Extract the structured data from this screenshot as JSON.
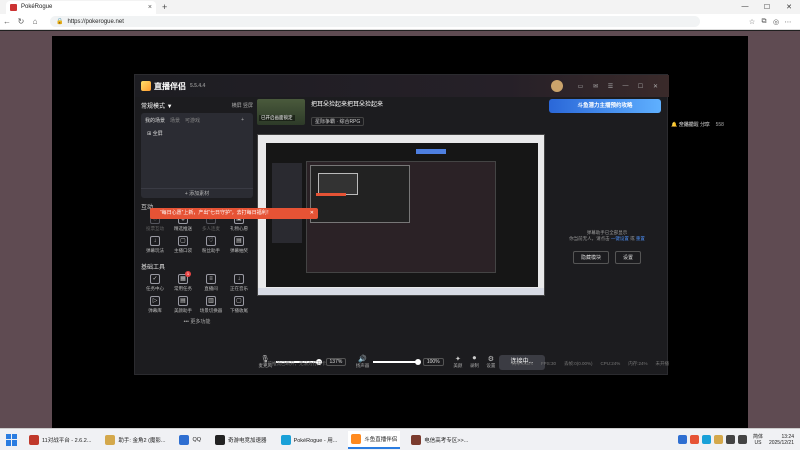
{
  "browser": {
    "tab_title": "PokéRogue",
    "url": "https://pokerogue.net"
  },
  "app": {
    "name": "直播伴侣",
    "version": "5.5.4.4",
    "left": {
      "mode_label": "常规模式 ▼",
      "mode_switch": "横屏  竖屏",
      "scene_tabs": [
        "我的场景",
        "场景",
        "可游戏"
      ],
      "scene_item": "全屏",
      "add_material": "+ 添加素材",
      "interactive_title": "互动",
      "interactive_items": [
        {
          "icon": "gift-icon",
          "label": "投票互动",
          "dim": true
        },
        {
          "icon": "shield-icon",
          "label": "精选推送",
          "dim": false
        },
        {
          "icon": "users-icon",
          "label": "多人连麦",
          "dim": true
        },
        {
          "icon": "gift-box-icon",
          "label": "礼物心愿",
          "dim": false
        },
        {
          "icon": "download-icon",
          "label": "弹幕玩法",
          "dim": false
        },
        {
          "icon": "cart-icon",
          "label": "主播口袋",
          "dim": false
        },
        {
          "icon": "star-icon",
          "label": "粉丝助手",
          "dim": false
        },
        {
          "icon": "image-icon",
          "label": "弹幕抽奖",
          "dim": false
        }
      ],
      "tools_title": "基础工具",
      "tool_items": [
        {
          "icon": "task-icon",
          "label": "任务中心",
          "badge": ""
        },
        {
          "icon": "calendar-icon",
          "label": "常用任务",
          "badge": "1"
        },
        {
          "icon": "list-icon",
          "label": "直播间",
          "badge": ""
        },
        {
          "icon": "download-icon",
          "label": "正在音乐",
          "badge": ""
        },
        {
          "icon": "play-icon",
          "label": "弹幕库",
          "badge": ""
        },
        {
          "icon": "image-icon",
          "label": "美颜助手",
          "badge": ""
        },
        {
          "icon": "grid-icon",
          "label": "场景切换器",
          "badge": ""
        },
        {
          "icon": "frame-icon",
          "label": "下播收尾",
          "badge": ""
        }
      ],
      "more": "••• 更多功能"
    },
    "toast": {
      "text": "“每日心愿”上新，产出“七日守护”，去打每日福利！"
    },
    "stream": {
      "title": "把耳朵捡起来把耳朵捡起来",
      "thumb_tag": "已开启画面锁定",
      "right_links": [
        "开播提醒",
        "分享"
      ],
      "chips": [
        "星际争霸 · 综合RPG"
      ],
      "meta_right": [
        "全站榜",
        "0",
        "558"
      ],
      "mic_label": "麦克风",
      "mic_pct": "137%",
      "speaker_label": "扬声器",
      "speaker_pct": "100%",
      "mic_level": 0.9,
      "speaker_level": 0.95,
      "ctl_icons": [
        {
          "icon": "effect-icon",
          "label": "美颜"
        },
        {
          "icon": "record-icon",
          "label": "录制"
        },
        {
          "icon": "settings-icon",
          "label": "设置"
        }
      ],
      "go_live": "连接中..."
    },
    "status": {
      "left": "当前推流已断开，无法为打开卡",
      "right": [
        "码率:0kb/s",
        "FPS:30",
        "丢帧:0(0.00%)",
        "CPU:24%",
        "内存:24%",
        "未开播"
      ]
    },
    "right": {
      "promo": "斗鱼潜力主播预约攻略",
      "note_line1": "弹幕助手已全部显示",
      "note_line2_pre": "你当前无人，请点击",
      "note_link1": "一键设置",
      "note_line2_post": "或",
      "note_link2": "重置",
      "btn1": "隐藏模块",
      "btn2": "设置"
    }
  },
  "taskbar": {
    "items": [
      {
        "label": "11对战平台 - 2.6.2...",
        "color": "#c0392b",
        "active": false
      },
      {
        "label": "助手: 金角2 (魔影...",
        "color": "#d4a84b",
        "active": false
      },
      {
        "label": "QQ",
        "color": "#2f6fd1",
        "active": false
      },
      {
        "label": "奇游电竞加速器",
        "color": "#222222",
        "active": false
      },
      {
        "label": "PokéRogue - 用...",
        "color": "#1aa1d8",
        "active": false
      },
      {
        "label": "斗鱼直播伴侣",
        "color": "#ff8a1f",
        "active": true
      },
      {
        "label": "电信高考专区>>...",
        "color": "#7b3b2e",
        "active": false
      }
    ],
    "lang_top": "简体",
    "lang_bottom": "US",
    "time": "13:24",
    "date": "2025/12/21"
  }
}
